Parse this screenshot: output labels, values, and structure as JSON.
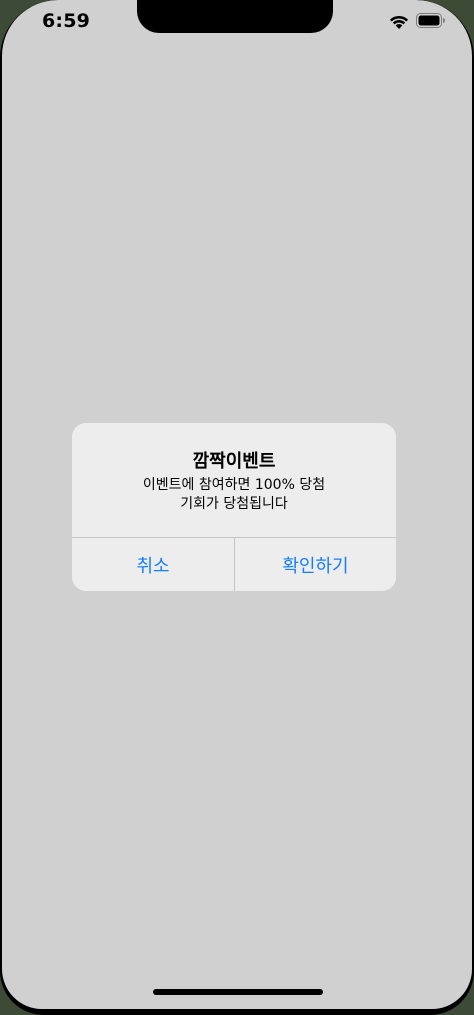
{
  "status_bar": {
    "time": "6:59",
    "icons": [
      "wifi-icon",
      "battery-icon"
    ]
  },
  "alert": {
    "title": "깜짝이벤트",
    "message_lines": [
      "이벤트에 참여하면 100% 당첨",
      "기회가 당첨됩니다"
    ],
    "cancel_label": "취소",
    "confirm_label": "확인하기"
  },
  "colors": {
    "background": "#d0d0d0",
    "alert_background": "#ededed",
    "button_text": "#147efb"
  }
}
